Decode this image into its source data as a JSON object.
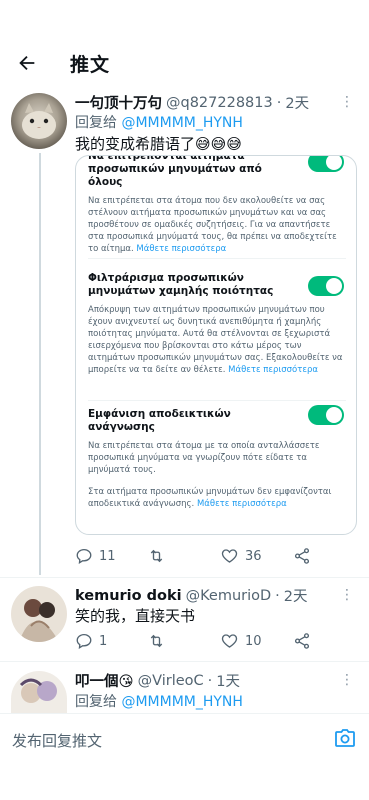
{
  "header": {
    "title": "推文"
  },
  "tweets": [
    {
      "name": "一句顶十万句",
      "handle": "@q827228813",
      "sep": "·",
      "time": "2天",
      "reply_prefix": "回复给",
      "reply_to": "@MMMMM_HYNH",
      "text": "我的变成希腊语了😅😅😅",
      "replies": "11",
      "retweets": "",
      "likes": "36"
    },
    {
      "name": "kemurio doki",
      "handle": "@KemurioD",
      "sep": "·",
      "time": "2天",
      "text": "笑的我，直接天书",
      "replies": "1",
      "retweets": "",
      "likes": "10"
    },
    {
      "name": "叩一個😘",
      "handle": "@VirleoC",
      "sep": "·",
      "time": "1天",
      "reply_prefix": "回复给",
      "reply_to": "@MMMMM_HYNH"
    }
  ],
  "screenshot": {
    "section1": {
      "title": "Να επιτρέπονται αιτήματα προσωπικών μηνυμάτων από όλους",
      "desc": "Να επιτρέπεται στα άτομα που δεν ακολουθείτε να σας στέλνουν αιτήματα προσωπικών μηνυμάτων και να σας προσθέτουν σε ομαδικές συζητήσεις. Για να απαντήσετε στα προσωπικά μηνύματά τους, θα πρέπει να αποδεχτείτε το αίτημα.",
      "link": "Μάθετε περισσότερα"
    },
    "section2": {
      "title": "Φιλτράρισμα προσωπικών μηνυμάτων χαμηλής ποιότητας",
      "desc": "Απόκρυψη των αιτημάτων προσωπικών μηνυμάτων που έχουν ανιχνευτεί ως δυνητικά ανεπιθύμητα ή χαμηλής ποιότητας μηνύματα. Αυτά θα στέλνονται σε ξεχωριστά εισερχόμενα που βρίσκονται στο κάτω μέρος των αιτημάτων προσωπικών μηνυμάτων σας. Εξακολουθείτε να μπορείτε να τα δείτε αν θέλετε.",
      "link": "Μάθετε περισσότερα"
    },
    "section3": {
      "title": "Εμφάνιση αποδεικτικών ανάγνωσης",
      "desc": "Να επιτρέπεται στα άτομα με τα οποία ανταλλάσσετε προσωπικά μηνύματα να γνωρίζουν πότε είδατε τα μηνύματά τους.",
      "desc2": "Στα αιτήματα προσωπικών μηνυμάτων δεν εμφανίζονται αποδεικτικά ανάγνωσης.",
      "link": "Μάθετε περισσότερα"
    }
  },
  "compose": {
    "placeholder": "发布回复推文"
  },
  "colors": {
    "accent": "#1d9bf0",
    "toggle": "#00ba7c",
    "secondary": "#536471"
  }
}
